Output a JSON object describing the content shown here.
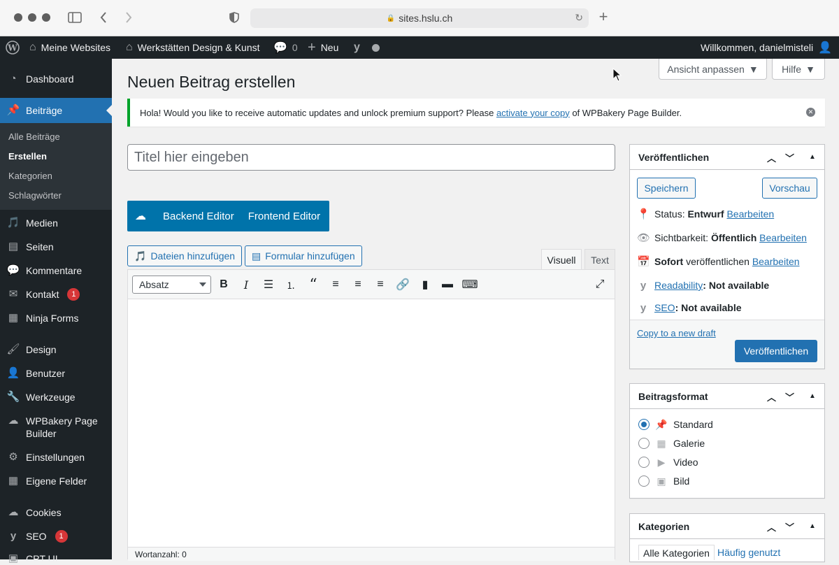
{
  "browser": {
    "url": "sites.hslu.ch"
  },
  "adminbar": {
    "sites": "Meine Websites",
    "site_name": "Werkstätten Design & Kunst",
    "comments_count": "0",
    "new": "Neu",
    "welcome": "Willkommen, danielmisteli"
  },
  "sidebar": {
    "items": [
      {
        "label": "Dashboard"
      },
      {
        "label": "Beiträge"
      },
      {
        "label": "Medien"
      },
      {
        "label": "Seiten"
      },
      {
        "label": "Kommentare"
      },
      {
        "label": "Kontakt",
        "badge": "1"
      },
      {
        "label": "Ninja Forms"
      },
      {
        "label": "Design"
      },
      {
        "label": "Benutzer"
      },
      {
        "label": "Werkzeuge"
      },
      {
        "label": "WPBakery Page Builder"
      },
      {
        "label": "Einstellungen"
      },
      {
        "label": "Eigene Felder"
      },
      {
        "label": "Cookies"
      },
      {
        "label": "SEO",
        "badge": "1"
      },
      {
        "label": "CPT UI"
      }
    ],
    "submenu": [
      "Alle Beiträge",
      "Erstellen",
      "Kategorien",
      "Schlagwörter"
    ]
  },
  "screen_options": "Ansicht anpassen",
  "help": "Hilfe",
  "page_title": "Neuen Beitrag erstellen",
  "notice": {
    "text_before": "Hola! Would you like to receive automatic updates and unlock premium support? Please ",
    "link": "activate your copy",
    "text_after": " of WPBakery Page Builder."
  },
  "title_placeholder": "Titel hier eingeben",
  "wpbakery": {
    "backend": "Backend Editor",
    "frontend": "Frontend Editor"
  },
  "media": {
    "add_files": "Dateien hinzufügen",
    "add_form": "Formular hinzufügen"
  },
  "editor_tabs": {
    "visual": "Visuell",
    "text": "Text"
  },
  "format_select": "Absatz",
  "word_count": "Wortanzahl: 0",
  "publish": {
    "title": "Veröffentlichen",
    "save": "Speichern",
    "preview": "Vorschau",
    "status_label": "Status: ",
    "status_value": "Entwurf",
    "visibility_label": "Sichtbarkeit: ",
    "visibility_value": "Öffentlich",
    "immediately": "Sofort",
    "publish_text": " veröffentlichen",
    "edit": "Bearbeiten",
    "readability": "Readability",
    "seo": "SEO",
    "not_available": ": Not available",
    "copy_draft": "Copy to a new draft",
    "publish_btn": "Veröffentlichen"
  },
  "format_box": {
    "title": "Beitragsformat",
    "options": [
      "Standard",
      "Galerie",
      "Video",
      "Bild"
    ],
    "selected": "Standard"
  },
  "categories": {
    "title": "Kategorien",
    "all": "Alle Kategorien",
    "popular": "Häufig genutzt"
  }
}
